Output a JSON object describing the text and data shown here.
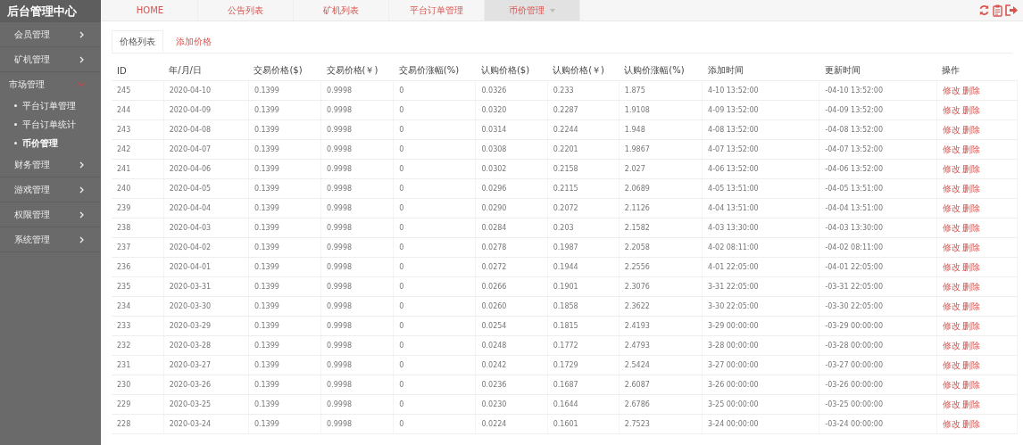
{
  "sidebar": {
    "title": "后台管理中心",
    "items": [
      {
        "label": "会员管理",
        "expanded": false
      },
      {
        "label": "矿机管理",
        "expanded": false
      },
      {
        "label": "市场管理",
        "expanded": true,
        "children": [
          {
            "label": "平台订单管理",
            "selected": false
          },
          {
            "label": "平台订单统计",
            "selected": false
          },
          {
            "label": "币价管理",
            "selected": true
          }
        ]
      },
      {
        "label": "财务管理",
        "expanded": false
      },
      {
        "label": "游戏管理",
        "expanded": false
      },
      {
        "label": "权限管理",
        "expanded": false
      },
      {
        "label": "系统管理",
        "expanded": false
      }
    ]
  },
  "top_tabs": [
    {
      "label": "HOME",
      "selected": false
    },
    {
      "label": "公告列表",
      "selected": false
    },
    {
      "label": "矿机列表",
      "selected": false
    },
    {
      "label": "平台订单管理",
      "selected": false
    },
    {
      "label": "币价管理",
      "selected": true
    }
  ],
  "sub_tabs": [
    {
      "label": "价格列表",
      "selected": true
    },
    {
      "label": "添加价格",
      "selected": false
    }
  ],
  "table": {
    "columns": [
      "ID",
      "年/月/日",
      "交易价格($)",
      "交易价格(￥)",
      "交易价涨幅(%)",
      "认购价格($)",
      "认购价格(￥)",
      "认购价涨幅(%)",
      "添加时间",
      "更新时间",
      "操作"
    ],
    "rows": [
      {
        "cells": [
          "245",
          "2020-04-10",
          "0.1399",
          "0.9998",
          "0",
          "0.0326",
          "0.233",
          "1.875",
          "4-10 13:52:00",
          "-04-10 13:52:00"
        ],
        "actions": [
          "修改",
          "删除"
        ]
      },
      {
        "cells": [
          "244",
          "2020-04-09",
          "0.1399",
          "0.9998",
          "0",
          "0.0320",
          "0.2287",
          "1.9108",
          "4-09 13:52:00",
          "-04-09 13:52:00"
        ],
        "actions": [
          "修改",
          "删除"
        ]
      },
      {
        "cells": [
          "243",
          "2020-04-08",
          "0.1399",
          "0.9998",
          "0",
          "0.0314",
          "0.2244",
          "1.948",
          "4-08 13:52:00",
          "-04-08 13:52:00"
        ],
        "actions": [
          "修改",
          "删除"
        ]
      },
      {
        "cells": [
          "242",
          "2020-04-07",
          "0.1399",
          "0.9998",
          "0",
          "0.0308",
          "0.2201",
          "1.9867",
          "4-07 13:52:00",
          "-04-07 13:52:00"
        ],
        "actions": [
          "修改",
          "删除"
        ]
      },
      {
        "cells": [
          "241",
          "2020-04-06",
          "0.1399",
          "0.9998",
          "0",
          "0.0302",
          "0.2158",
          "2.027",
          "4-06 13:52:00",
          "-04-06 13:52:00"
        ],
        "actions": [
          "修改",
          "删除"
        ]
      },
      {
        "cells": [
          "240",
          "2020-04-05",
          "0.1399",
          "0.9998",
          "0",
          "0.0296",
          "0.2115",
          "2.0689",
          "4-05 13:51:00",
          "-04-05 13:51:00"
        ],
        "actions": [
          "修改",
          "删除"
        ]
      },
      {
        "cells": [
          "239",
          "2020-04-04",
          "0.1399",
          "0.9998",
          "0",
          "0.0290",
          "0.2072",
          "2.1126",
          "4-04 13:51:00",
          "-04-04 13:51:00"
        ],
        "actions": [
          "修改",
          "删除"
        ]
      },
      {
        "cells": [
          "238",
          "2020-04-03",
          "0.1399",
          "0.9998",
          "0",
          "0.0284",
          "0.203",
          "2.1582",
          "4-03 13:30:00",
          "-04-03 13:30:00"
        ],
        "actions": [
          "修改",
          "删除"
        ]
      },
      {
        "cells": [
          "237",
          "2020-04-02",
          "0.1399",
          "0.9998",
          "0",
          "0.0278",
          "0.1987",
          "2.2058",
          "4-02 08:11:00",
          "-04-02 08:11:00"
        ],
        "actions": [
          "修改",
          "删除"
        ]
      },
      {
        "cells": [
          "236",
          "2020-04-01",
          "0.1399",
          "0.9998",
          "0",
          "0.0272",
          "0.1944",
          "2.2556",
          "4-01 22:05:00",
          "-04-01 22:05:00"
        ],
        "actions": [
          "修改",
          "删除"
        ]
      },
      {
        "cells": [
          "235",
          "2020-03-31",
          "0.1399",
          "0.9998",
          "0",
          "0.0266",
          "0.1901",
          "2.3076",
          "3-31 22:05:00",
          "-03-31 22:05:00"
        ],
        "actions": [
          "修改",
          "删除"
        ]
      },
      {
        "cells": [
          "234",
          "2020-03-30",
          "0.1399",
          "0.9998",
          "0",
          "0.0260",
          "0.1858",
          "2.3622",
          "3-30 22:05:00",
          "-03-30 22:05:00"
        ],
        "actions": [
          "修改",
          "删除"
        ]
      },
      {
        "cells": [
          "233",
          "2020-03-29",
          "0.1399",
          "0.9998",
          "0",
          "0.0254",
          "0.1815",
          "2.4193",
          "3-29 00:00:00",
          "-03-29 00:00:00"
        ],
        "actions": [
          "修改",
          "删除"
        ]
      },
      {
        "cells": [
          "232",
          "2020-03-28",
          "0.1399",
          "0.9998",
          "0",
          "0.0248",
          "0.1772",
          "2.4793",
          "3-28 00:00:00",
          "-03-28 00:00:00"
        ],
        "actions": [
          "修改",
          "删除"
        ]
      },
      {
        "cells": [
          "231",
          "2020-03-27",
          "0.1399",
          "0.9998",
          "0",
          "0.0242",
          "0.1729",
          "2.5424",
          "3-27 00:00:00",
          "-03-27 00:00:00"
        ],
        "actions": [
          "修改",
          "删除"
        ]
      },
      {
        "cells": [
          "230",
          "2020-03-26",
          "0.1399",
          "0.9998",
          "0",
          "0.0236",
          "0.1687",
          "2.6087",
          "3-26 00:00:00",
          "-03-26 00:00:00"
        ],
        "actions": [
          "修改",
          "删除"
        ]
      },
      {
        "cells": [
          "229",
          "2020-03-25",
          "0.1399",
          "0.9998",
          "0",
          "0.0230",
          "0.1644",
          "2.6786",
          "3-25 00:00:00",
          "-03-25 00:00:00"
        ],
        "actions": [
          "修改",
          "删除"
        ]
      },
      {
        "cells": [
          "228",
          "2020-03-24",
          "0.1399",
          "0.9998",
          "0",
          "0.0224",
          "0.1601",
          "2.7523",
          "3-24 00:00:00",
          "-03-24 00:00:00"
        ],
        "actions": [
          "修改",
          "删除"
        ]
      }
    ]
  }
}
